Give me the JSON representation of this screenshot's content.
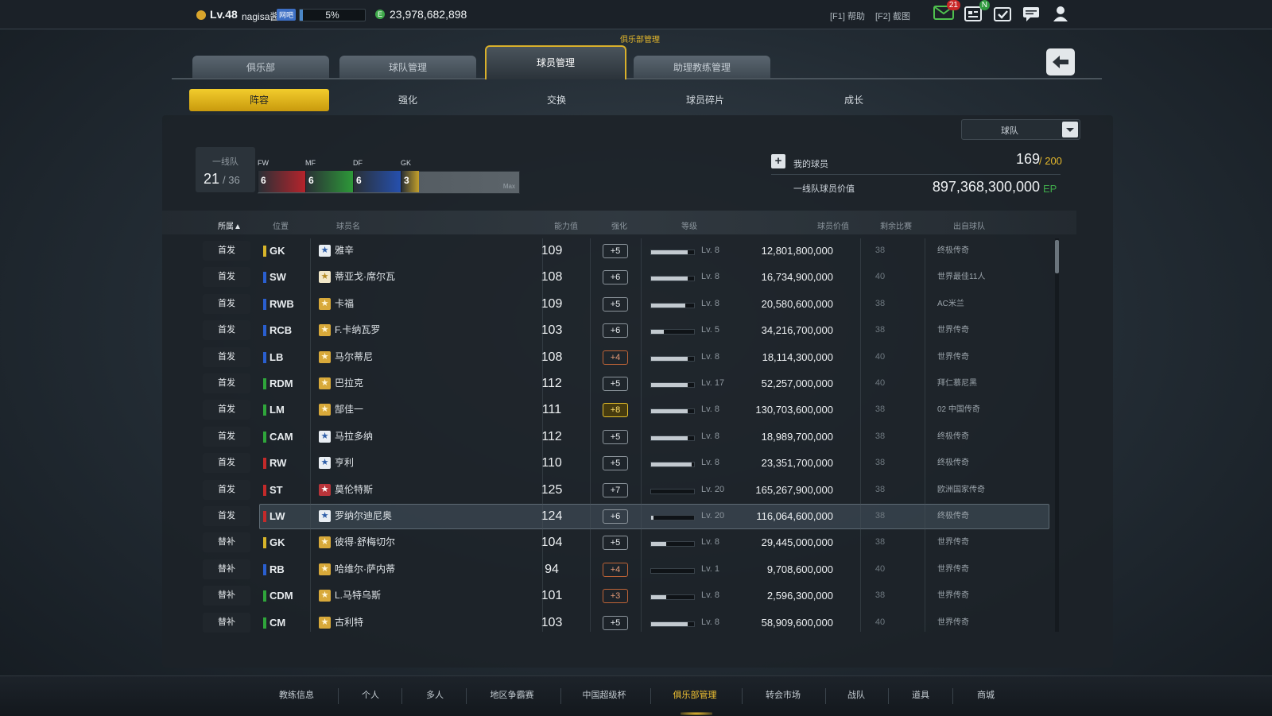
{
  "topbar": {
    "level": "Lv.48",
    "username": "nagisa酱",
    "vip_tag": "网吧",
    "exp_percent": "5%",
    "exp_fraction": 0.05,
    "currency": "23,978,682,898",
    "help": "[F1] 帮助",
    "screenshot": "[F2] 截图",
    "mail_badge": "21",
    "news_badge": "N"
  },
  "page": {
    "section_title": "俱乐部管理"
  },
  "main_tabs": [
    "俱乐部",
    "球队管理",
    "球员管理",
    "助理教练管理"
  ],
  "main_tab_active": 2,
  "sub_tabs": [
    "阵容",
    "强化",
    "交换",
    "球员碎片",
    "成长"
  ],
  "sub_tab_active": 0,
  "filter": {
    "selected": "球队"
  },
  "squad": {
    "label": "一线队",
    "count": "21",
    "max": "/ 36",
    "segments": [
      {
        "pos": "FW",
        "count": "6",
        "color": "#b8232b"
      },
      {
        "pos": "MF",
        "count": "6",
        "color": "#2d9a38"
      },
      {
        "pos": "DF",
        "count": "6",
        "color": "#2550b0"
      },
      {
        "pos": "GK",
        "count": "3",
        "color": "#c3a02a"
      }
    ],
    "max_label": "Max"
  },
  "summary": {
    "my_players_label": "我的球员",
    "my_players_count": "169",
    "my_players_max": "/ 200",
    "value_label": "一线队球员价值",
    "value": "897,368,300,000",
    "value_unit": "EP"
  },
  "columns": [
    "所属▲",
    "位置",
    "球员名",
    "能力值",
    "强化",
    "等级",
    "球员价值",
    "剩余比赛",
    "出自球队"
  ],
  "players": [
    {
      "role": "首发",
      "pos": "GK",
      "pos_color": "#d8b52a",
      "star": "blue",
      "name": "雅辛",
      "ovr": "109",
      "enh": "+5",
      "enh_style": "silver",
      "lv": "Lv. 8",
      "lv_fill": 0.85,
      "value": "12,801,800,000",
      "games": "38",
      "team": "终极传奇"
    },
    {
      "role": "首发",
      "pos": "SW",
      "pos_color": "#2a5fd0",
      "star": "gold-light",
      "name": "蒂亚戈·席尔瓦",
      "ovr": "108",
      "enh": "+6",
      "enh_style": "silver",
      "lv": "Lv. 8",
      "lv_fill": 0.85,
      "value": "16,734,900,000",
      "games": "40",
      "team": "世界最佳11人"
    },
    {
      "role": "首发",
      "pos": "RWB",
      "pos_color": "#2a5fd0",
      "star": "gold",
      "name": "卡福",
      "ovr": "109",
      "enh": "+5",
      "enh_style": "silver",
      "lv": "Lv. 8",
      "lv_fill": 0.8,
      "value": "20,580,600,000",
      "games": "38",
      "team": "AC米兰"
    },
    {
      "role": "首发",
      "pos": "RCB",
      "pos_color": "#2a5fd0",
      "star": "gold",
      "name": "F.卡纳瓦罗",
      "ovr": "103",
      "enh": "+6",
      "enh_style": "silver",
      "lv": "Lv. 5",
      "lv_fill": 0.3,
      "value": "34,216,700,000",
      "games": "38",
      "team": "世界传奇"
    },
    {
      "role": "首发",
      "pos": "LB",
      "pos_color": "#2a5fd0",
      "star": "gold",
      "name": "马尔蒂尼",
      "ovr": "108",
      "enh": "+4",
      "enh_style": "bronze",
      "lv": "Lv. 8",
      "lv_fill": 0.85,
      "value": "18,114,300,000",
      "games": "40",
      "team": "世界传奇"
    },
    {
      "role": "首发",
      "pos": "RDM",
      "pos_color": "#2fa63b",
      "star": "gold",
      "name": "巴拉克",
      "ovr": "112",
      "enh": "+5",
      "enh_style": "silver",
      "lv": "Lv. 17",
      "lv_fill": 0.85,
      "value": "52,257,000,000",
      "games": "40",
      "team": "拜仁慕尼黑"
    },
    {
      "role": "首发",
      "pos": "LM",
      "pos_color": "#2fa63b",
      "star": "gold",
      "name": "郜佳一",
      "ovr": "111",
      "enh": "+8",
      "enh_style": "gold",
      "lv": "Lv. 8",
      "lv_fill": 0.85,
      "value": "130,703,600,000",
      "games": "38",
      "team": "02 中国传奇"
    },
    {
      "role": "首发",
      "pos": "CAM",
      "pos_color": "#2fa63b",
      "star": "blue",
      "name": "马拉多纳",
      "ovr": "112",
      "enh": "+5",
      "enh_style": "silver",
      "lv": "Lv. 8",
      "lv_fill": 0.85,
      "value": "18,989,700,000",
      "games": "38",
      "team": "终极传奇"
    },
    {
      "role": "首发",
      "pos": "RW",
      "pos_color": "#c42a2a",
      "star": "blue",
      "name": "亨利",
      "ovr": "110",
      "enh": "+5",
      "enh_style": "silver",
      "lv": "Lv. 8",
      "lv_fill": 0.95,
      "value": "23,351,700,000",
      "games": "38",
      "team": "终极传奇"
    },
    {
      "role": "首发",
      "pos": "ST",
      "pos_color": "#c42a2a",
      "star": "red",
      "name": "莫伦特斯",
      "ovr": "125",
      "enh": "+7",
      "enh_style": "silver",
      "lv": "Lv. 20",
      "lv_fill": 0.0,
      "value": "165,267,900,000",
      "games": "38",
      "team": "欧洲国家传奇"
    },
    {
      "role": "首发",
      "pos": "LW",
      "pos_color": "#c42a2a",
      "star": "blue",
      "name": "罗纳尔迪尼奥",
      "ovr": "124",
      "enh": "+6",
      "enh_style": "silver",
      "lv": "Lv. 20",
      "lv_fill": 0.05,
      "value": "116,064,600,000",
      "games": "38",
      "team": "终极传奇",
      "selected": true
    },
    {
      "role": "替补",
      "pos": "GK",
      "pos_color": "#d8b52a",
      "star": "gold",
      "name": "彼得·舒梅切尔",
      "ovr": "104",
      "enh": "+5",
      "enh_style": "silver",
      "lv": "Lv. 8",
      "lv_fill": 0.35,
      "value": "29,445,000,000",
      "games": "38",
      "team": "世界传奇"
    },
    {
      "role": "替补",
      "pos": "RB",
      "pos_color": "#2a5fd0",
      "star": "gold",
      "name": "哈维尔·萨内蒂",
      "ovr": "94",
      "enh": "+4",
      "enh_style": "bronze",
      "lv": "Lv. 1",
      "lv_fill": 0.0,
      "value": "9,708,600,000",
      "games": "40",
      "team": "世界传奇"
    },
    {
      "role": "替补",
      "pos": "CDM",
      "pos_color": "#2fa63b",
      "star": "gold",
      "name": "L.马特乌斯",
      "ovr": "101",
      "enh": "+3",
      "enh_style": "bronze",
      "lv": "Lv. 8",
      "lv_fill": 0.35,
      "value": "2,596,300,000",
      "games": "38",
      "team": "世界传奇"
    },
    {
      "role": "替补",
      "pos": "CM",
      "pos_color": "#2fa63b",
      "star": "gold",
      "name": "古利特",
      "ovr": "103",
      "enh": "+5",
      "enh_style": "silver",
      "lv": "Lv. 8",
      "lv_fill": 0.85,
      "value": "58,909,600,000",
      "games": "40",
      "team": "世界传奇"
    }
  ],
  "bottom_nav": [
    "教练信息",
    "个人",
    "多人",
    "地区争霸赛",
    "中国超级杯",
    "俱乐部管理",
    "转会市场",
    "战队",
    "道具",
    "商城"
  ],
  "bottom_nav_active": 5
}
